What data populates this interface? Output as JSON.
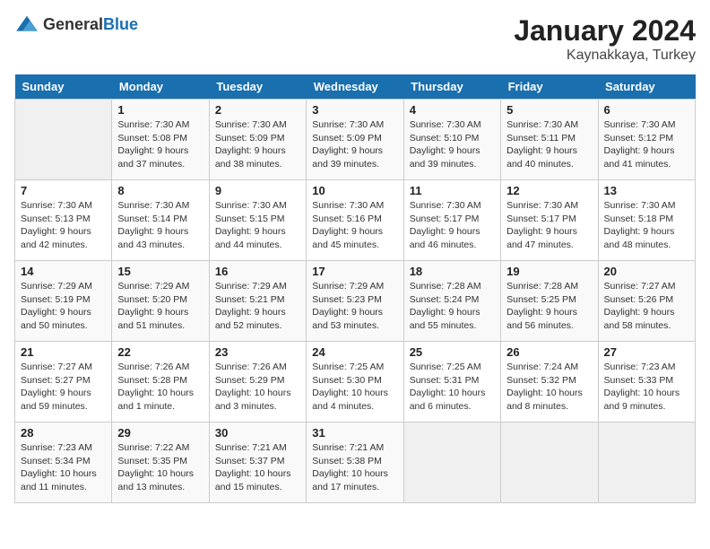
{
  "header": {
    "logo_general": "General",
    "logo_blue": "Blue",
    "month_year": "January 2024",
    "location": "Kaynakkaya, Turkey"
  },
  "days_of_week": [
    "Sunday",
    "Monday",
    "Tuesday",
    "Wednesday",
    "Thursday",
    "Friday",
    "Saturday"
  ],
  "weeks": [
    [
      {
        "day": "",
        "sunrise": "",
        "sunset": "",
        "daylight": ""
      },
      {
        "day": "1",
        "sunrise": "Sunrise: 7:30 AM",
        "sunset": "Sunset: 5:08 PM",
        "daylight": "Daylight: 9 hours and 37 minutes."
      },
      {
        "day": "2",
        "sunrise": "Sunrise: 7:30 AM",
        "sunset": "Sunset: 5:09 PM",
        "daylight": "Daylight: 9 hours and 38 minutes."
      },
      {
        "day": "3",
        "sunrise": "Sunrise: 7:30 AM",
        "sunset": "Sunset: 5:09 PM",
        "daylight": "Daylight: 9 hours and 39 minutes."
      },
      {
        "day": "4",
        "sunrise": "Sunrise: 7:30 AM",
        "sunset": "Sunset: 5:10 PM",
        "daylight": "Daylight: 9 hours and 39 minutes."
      },
      {
        "day": "5",
        "sunrise": "Sunrise: 7:30 AM",
        "sunset": "Sunset: 5:11 PM",
        "daylight": "Daylight: 9 hours and 40 minutes."
      },
      {
        "day": "6",
        "sunrise": "Sunrise: 7:30 AM",
        "sunset": "Sunset: 5:12 PM",
        "daylight": "Daylight: 9 hours and 41 minutes."
      }
    ],
    [
      {
        "day": "7",
        "sunrise": "Sunrise: 7:30 AM",
        "sunset": "Sunset: 5:13 PM",
        "daylight": "Daylight: 9 hours and 42 minutes."
      },
      {
        "day": "8",
        "sunrise": "Sunrise: 7:30 AM",
        "sunset": "Sunset: 5:14 PM",
        "daylight": "Daylight: 9 hours and 43 minutes."
      },
      {
        "day": "9",
        "sunrise": "Sunrise: 7:30 AM",
        "sunset": "Sunset: 5:15 PM",
        "daylight": "Daylight: 9 hours and 44 minutes."
      },
      {
        "day": "10",
        "sunrise": "Sunrise: 7:30 AM",
        "sunset": "Sunset: 5:16 PM",
        "daylight": "Daylight: 9 hours and 45 minutes."
      },
      {
        "day": "11",
        "sunrise": "Sunrise: 7:30 AM",
        "sunset": "Sunset: 5:17 PM",
        "daylight": "Daylight: 9 hours and 46 minutes."
      },
      {
        "day": "12",
        "sunrise": "Sunrise: 7:30 AM",
        "sunset": "Sunset: 5:17 PM",
        "daylight": "Daylight: 9 hours and 47 minutes."
      },
      {
        "day": "13",
        "sunrise": "Sunrise: 7:30 AM",
        "sunset": "Sunset: 5:18 PM",
        "daylight": "Daylight: 9 hours and 48 minutes."
      }
    ],
    [
      {
        "day": "14",
        "sunrise": "Sunrise: 7:29 AM",
        "sunset": "Sunset: 5:19 PM",
        "daylight": "Daylight: 9 hours and 50 minutes."
      },
      {
        "day": "15",
        "sunrise": "Sunrise: 7:29 AM",
        "sunset": "Sunset: 5:20 PM",
        "daylight": "Daylight: 9 hours and 51 minutes."
      },
      {
        "day": "16",
        "sunrise": "Sunrise: 7:29 AM",
        "sunset": "Sunset: 5:21 PM",
        "daylight": "Daylight: 9 hours and 52 minutes."
      },
      {
        "day": "17",
        "sunrise": "Sunrise: 7:29 AM",
        "sunset": "Sunset: 5:23 PM",
        "daylight": "Daylight: 9 hours and 53 minutes."
      },
      {
        "day": "18",
        "sunrise": "Sunrise: 7:28 AM",
        "sunset": "Sunset: 5:24 PM",
        "daylight": "Daylight: 9 hours and 55 minutes."
      },
      {
        "day": "19",
        "sunrise": "Sunrise: 7:28 AM",
        "sunset": "Sunset: 5:25 PM",
        "daylight": "Daylight: 9 hours and 56 minutes."
      },
      {
        "day": "20",
        "sunrise": "Sunrise: 7:27 AM",
        "sunset": "Sunset: 5:26 PM",
        "daylight": "Daylight: 9 hours and 58 minutes."
      }
    ],
    [
      {
        "day": "21",
        "sunrise": "Sunrise: 7:27 AM",
        "sunset": "Sunset: 5:27 PM",
        "daylight": "Daylight: 9 hours and 59 minutes."
      },
      {
        "day": "22",
        "sunrise": "Sunrise: 7:26 AM",
        "sunset": "Sunset: 5:28 PM",
        "daylight": "Daylight: 10 hours and 1 minute."
      },
      {
        "day": "23",
        "sunrise": "Sunrise: 7:26 AM",
        "sunset": "Sunset: 5:29 PM",
        "daylight": "Daylight: 10 hours and 3 minutes."
      },
      {
        "day": "24",
        "sunrise": "Sunrise: 7:25 AM",
        "sunset": "Sunset: 5:30 PM",
        "daylight": "Daylight: 10 hours and 4 minutes."
      },
      {
        "day": "25",
        "sunrise": "Sunrise: 7:25 AM",
        "sunset": "Sunset: 5:31 PM",
        "daylight": "Daylight: 10 hours and 6 minutes."
      },
      {
        "day": "26",
        "sunrise": "Sunrise: 7:24 AM",
        "sunset": "Sunset: 5:32 PM",
        "daylight": "Daylight: 10 hours and 8 minutes."
      },
      {
        "day": "27",
        "sunrise": "Sunrise: 7:23 AM",
        "sunset": "Sunset: 5:33 PM",
        "daylight": "Daylight: 10 hours and 9 minutes."
      }
    ],
    [
      {
        "day": "28",
        "sunrise": "Sunrise: 7:23 AM",
        "sunset": "Sunset: 5:34 PM",
        "daylight": "Daylight: 10 hours and 11 minutes."
      },
      {
        "day": "29",
        "sunrise": "Sunrise: 7:22 AM",
        "sunset": "Sunset: 5:35 PM",
        "daylight": "Daylight: 10 hours and 13 minutes."
      },
      {
        "day": "30",
        "sunrise": "Sunrise: 7:21 AM",
        "sunset": "Sunset: 5:37 PM",
        "daylight": "Daylight: 10 hours and 15 minutes."
      },
      {
        "day": "31",
        "sunrise": "Sunrise: 7:21 AM",
        "sunset": "Sunset: 5:38 PM",
        "daylight": "Daylight: 10 hours and 17 minutes."
      },
      {
        "day": "",
        "sunrise": "",
        "sunset": "",
        "daylight": ""
      },
      {
        "day": "",
        "sunrise": "",
        "sunset": "",
        "daylight": ""
      },
      {
        "day": "",
        "sunrise": "",
        "sunset": "",
        "daylight": ""
      }
    ]
  ]
}
